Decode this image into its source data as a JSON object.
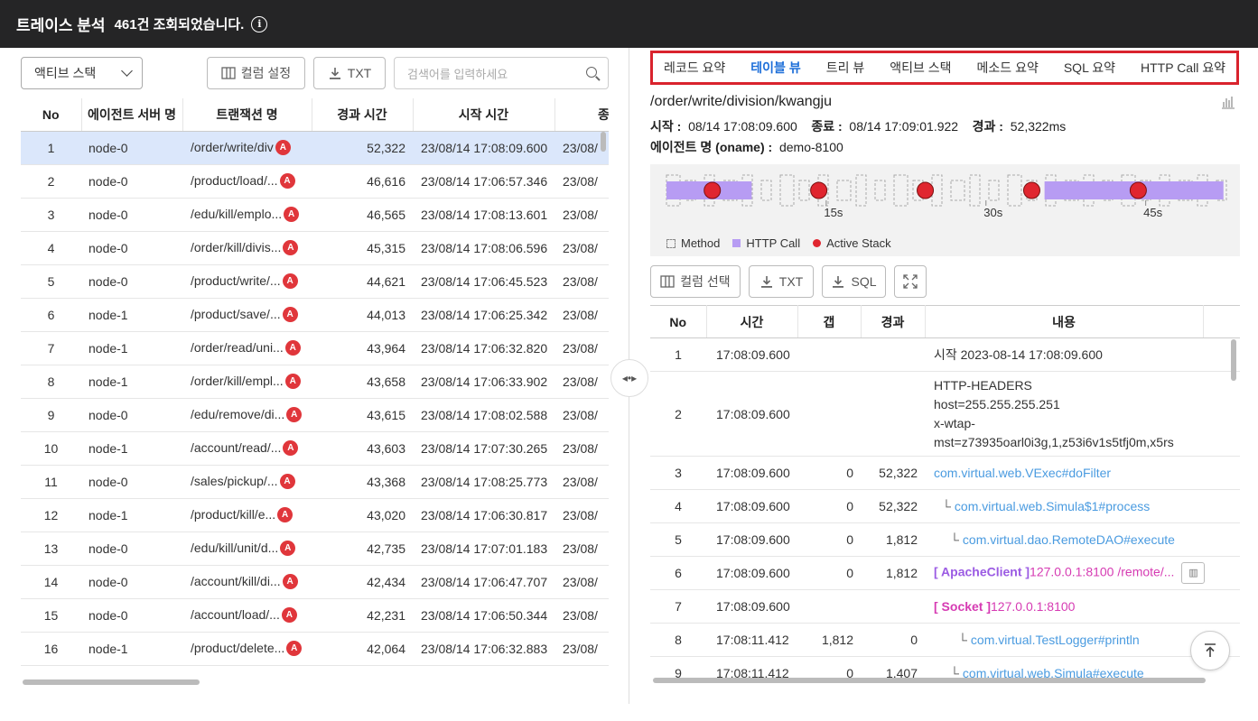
{
  "header": {
    "title": "트레이스 분석",
    "count_text": "461건 조회되었습니다.",
    "info_icon": "info-icon"
  },
  "left": {
    "select_value": "액티브 스택",
    "column_settings": "컬럼 설정",
    "txt_button": "TXT",
    "search_placeholder": "검색어를 입력하세요",
    "columns": [
      "No",
      "에이전트 서버 명",
      "트랜잭션 명",
      "경과 시간",
      "시작 시간",
      "종"
    ],
    "rows": [
      {
        "no": "1",
        "agent": "node-0",
        "tx": "/order/write/div",
        "elapsed": "52,322",
        "start": "23/08/14 17:08:09.600",
        "end": "23/08/"
      },
      {
        "no": "2",
        "agent": "node-0",
        "tx": "/product/load/...",
        "elapsed": "46,616",
        "start": "23/08/14 17:06:57.346",
        "end": "23/08/"
      },
      {
        "no": "3",
        "agent": "node-0",
        "tx": "/edu/kill/emplo...",
        "elapsed": "46,565",
        "start": "23/08/14 17:08:13.601",
        "end": "23/08/"
      },
      {
        "no": "4",
        "agent": "node-0",
        "tx": "/order/kill/divis...",
        "elapsed": "45,315",
        "start": "23/08/14 17:08:06.596",
        "end": "23/08/"
      },
      {
        "no": "5",
        "agent": "node-0",
        "tx": "/product/write/...",
        "elapsed": "44,621",
        "start": "23/08/14 17:06:45.523",
        "end": "23/08/"
      },
      {
        "no": "6",
        "agent": "node-1",
        "tx": "/product/save/...",
        "elapsed": "44,013",
        "start": "23/08/14 17:06:25.342",
        "end": "23/08/"
      },
      {
        "no": "7",
        "agent": "node-1",
        "tx": "/order/read/uni...",
        "elapsed": "43,964",
        "start": "23/08/14 17:06:32.820",
        "end": "23/08/"
      },
      {
        "no": "8",
        "agent": "node-1",
        "tx": "/order/kill/empl...",
        "elapsed": "43,658",
        "start": "23/08/14 17:06:33.902",
        "end": "23/08/"
      },
      {
        "no": "9",
        "agent": "node-0",
        "tx": "/edu/remove/di...",
        "elapsed": "43,615",
        "start": "23/08/14 17:08:02.588",
        "end": "23/08/"
      },
      {
        "no": "10",
        "agent": "node-1",
        "tx": "/account/read/...",
        "elapsed": "43,603",
        "start": "23/08/14 17:07:30.265",
        "end": "23/08/"
      },
      {
        "no": "11",
        "agent": "node-0",
        "tx": "/sales/pickup/...",
        "elapsed": "43,368",
        "start": "23/08/14 17:08:25.773",
        "end": "23/08/"
      },
      {
        "no": "12",
        "agent": "node-1",
        "tx": "/product/kill/e...",
        "elapsed": "43,020",
        "start": "23/08/14 17:06:30.817",
        "end": "23/08/"
      },
      {
        "no": "13",
        "agent": "node-0",
        "tx": "/edu/kill/unit/d...",
        "elapsed": "42,735",
        "start": "23/08/14 17:07:01.183",
        "end": "23/08/"
      },
      {
        "no": "14",
        "agent": "node-0",
        "tx": "/account/kill/di...",
        "elapsed": "42,434",
        "start": "23/08/14 17:06:47.707",
        "end": "23/08/"
      },
      {
        "no": "15",
        "agent": "node-0",
        "tx": "/account/load/...",
        "elapsed": "42,231",
        "start": "23/08/14 17:06:50.344",
        "end": "23/08/"
      },
      {
        "no": "16",
        "agent": "node-1",
        "tx": "/product/delete...",
        "elapsed": "42,064",
        "start": "23/08/14 17:06:32.883",
        "end": "23/08/"
      }
    ],
    "badge": "A"
  },
  "right": {
    "tabs": [
      "레코드 요약",
      "테이블 뷰",
      "트리 뷰",
      "액티브 스택",
      "메소드 요약",
      "SQL 요약",
      "HTTP Call 요약"
    ],
    "active_tab": "테이블 뷰",
    "more": "···",
    "path": "/order/write/division/kwangju",
    "start_label": "시작 :",
    "start_value": "08/14 17:08:09.600",
    "end_label": "종료 :",
    "end_value": "08/14 17:09:01.922",
    "elapsed_label": "경과 :",
    "elapsed_value": "52,322ms",
    "agent_label": "에이전트 명 (oname) :",
    "agent_value": "demo-8100",
    "timeline": {
      "ticks": [
        "15s",
        "30s",
        "45s"
      ],
      "legend": [
        "Method",
        "HTTP Call",
        "Active Stack"
      ],
      "active_stack_seconds": [
        4.3,
        14.3,
        24.3,
        34.3,
        44.3
      ],
      "http_call_ranges_seconds": [
        [
          0,
          8
        ],
        [
          35.5,
          52.3
        ]
      ],
      "total_seconds": 52.322,
      "colors": {
        "http": "#b79cf3",
        "active": "#e0262f"
      }
    },
    "buttons": {
      "column_select": "컬럼 선택",
      "txt": "TXT",
      "sql": "SQL"
    },
    "columns": [
      "No",
      "시간",
      "갭",
      "경과",
      "내용"
    ],
    "rows": [
      {
        "no": "1",
        "time": "17:08:09.600",
        "gap": "",
        "elapsed": "",
        "content": "시작  2023-08-14 17:08:09.600",
        "type": "plain"
      },
      {
        "no": "2",
        "time": "17:08:09.600",
        "gap": "",
        "elapsed": "",
        "content_lines": [
          "HTTP-HEADERS",
          "host=255.255.255.251",
          "x-wtap-",
          "mst=z73935oarl0i3g,1,z53i6v1s5tfj0m,x5rs"
        ],
        "type": "multi"
      },
      {
        "no": "3",
        "time": "17:08:09.600",
        "gap": "0",
        "elapsed": "52,322",
        "content": "com.virtual.web.VExec#doFilter",
        "type": "link",
        "indent": 0
      },
      {
        "no": "4",
        "time": "17:08:09.600",
        "gap": "0",
        "elapsed": "52,322",
        "content": "com.virtual.web.Simula$1#process",
        "type": "link",
        "indent": 1
      },
      {
        "no": "5",
        "time": "17:08:09.600",
        "gap": "0",
        "elapsed": "1,812",
        "content": "com.virtual.dao.RemoteDAO#execute",
        "type": "link",
        "indent": 2
      },
      {
        "no": "6",
        "time": "17:08:09.600",
        "gap": "0",
        "elapsed": "1,812",
        "tag": "[ ApacheClient ]",
        "content": "127.0.0.1:8100 /remote/...",
        "type": "apache"
      },
      {
        "no": "7",
        "time": "17:08:09.600",
        "gap": "",
        "elapsed": "",
        "tag": "[ Socket ]",
        "content": "127.0.0.1:8100",
        "type": "socket"
      },
      {
        "no": "8",
        "time": "17:08:11.412",
        "gap": "1,812",
        "elapsed": "0",
        "content": "com.virtual.TestLogger#println",
        "type": "link",
        "indent": 3
      },
      {
        "no": "9",
        "time": "17:08:11.412",
        "gap": "0",
        "elapsed": "1,407",
        "content": "com.virtual.web.Simula#execute",
        "type": "link",
        "indent": 2
      }
    ]
  }
}
